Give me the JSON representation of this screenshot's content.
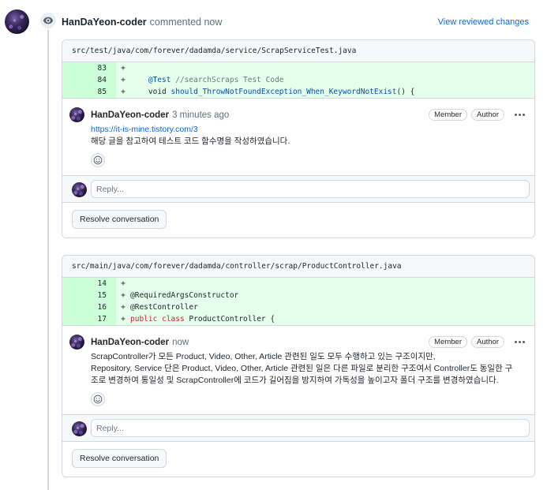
{
  "header": {
    "author": "HanDaYeon-coder",
    "action": "commented now",
    "view_changes_label": "View reviewed changes"
  },
  "threads": [
    {
      "file_path": "src/test/java/com/forever/dadamda/service/ScrapServiceTest.java",
      "lines": [
        {
          "num": "83",
          "sign": "+",
          "code": ""
        },
        {
          "num": "84",
          "sign": "+",
          "code_ann": "@Test",
          "code_comment": "//searchScraps Test Code"
        },
        {
          "num": "85",
          "sign": "+",
          "code_void": "void",
          "code_fn": "should_ThrowNotFoundException_When_KeywordNotExist",
          "code_tail": "() {"
        }
      ],
      "comment": {
        "author": "HanDaYeon-coder",
        "time": "3 minutes ago",
        "badges": [
          "Member",
          "Author"
        ],
        "link": "https://it-is-mine.tistory.com/3",
        "body": [
          "해당 글을 참고하여 테스트 코드 함수명을 작성하였습니다."
        ]
      },
      "reply_placeholder": "Reply...",
      "resolve_label": "Resolve conversation"
    },
    {
      "file_path": "src/main/java/com/forever/dadamda/controller/scrap/ProductController.java",
      "lines": [
        {
          "num": "14",
          "sign": "+",
          "code": ""
        },
        {
          "num": "15",
          "sign": "+",
          "code": "@RequiredArgsConstructor"
        },
        {
          "num": "16",
          "sign": "+",
          "code": "@RestController"
        },
        {
          "num": "17",
          "sign": "+",
          "code_kw1": "public",
          "code_kw2": "class",
          "code_tail": "ProductController {"
        }
      ],
      "comment": {
        "author": "HanDaYeon-coder",
        "time": "now",
        "badges": [
          "Member",
          "Author"
        ],
        "body": [
          "ScrapController가 모든 Product, Video, Other, Article 관련된 일도 모두 수행하고 있는 구조이지만,",
          "Repository, Service 단은 Product, Video, Other, Article 관련된 일은 다른 파일로 분리한 구조여서 Controller도 동일한 구",
          "조로 변경하여 통일성 및 ScrapController에 코드가 길어짐을 방지하여 가독성을 높이고자 폴더 구조를 변경하였습니다."
        ]
      },
      "reply_placeholder": "Reply...",
      "resolve_label": "Resolve conversation"
    }
  ],
  "icons": {
    "timeline": "eye-icon",
    "reaction": "smiley-icon",
    "more": "kebab-horizontal-icon"
  },
  "colors": {
    "addition_bg": "#e6ffec",
    "addition_num_bg": "#ccffd8",
    "link": "#0969da",
    "border": "#d0d7de"
  }
}
